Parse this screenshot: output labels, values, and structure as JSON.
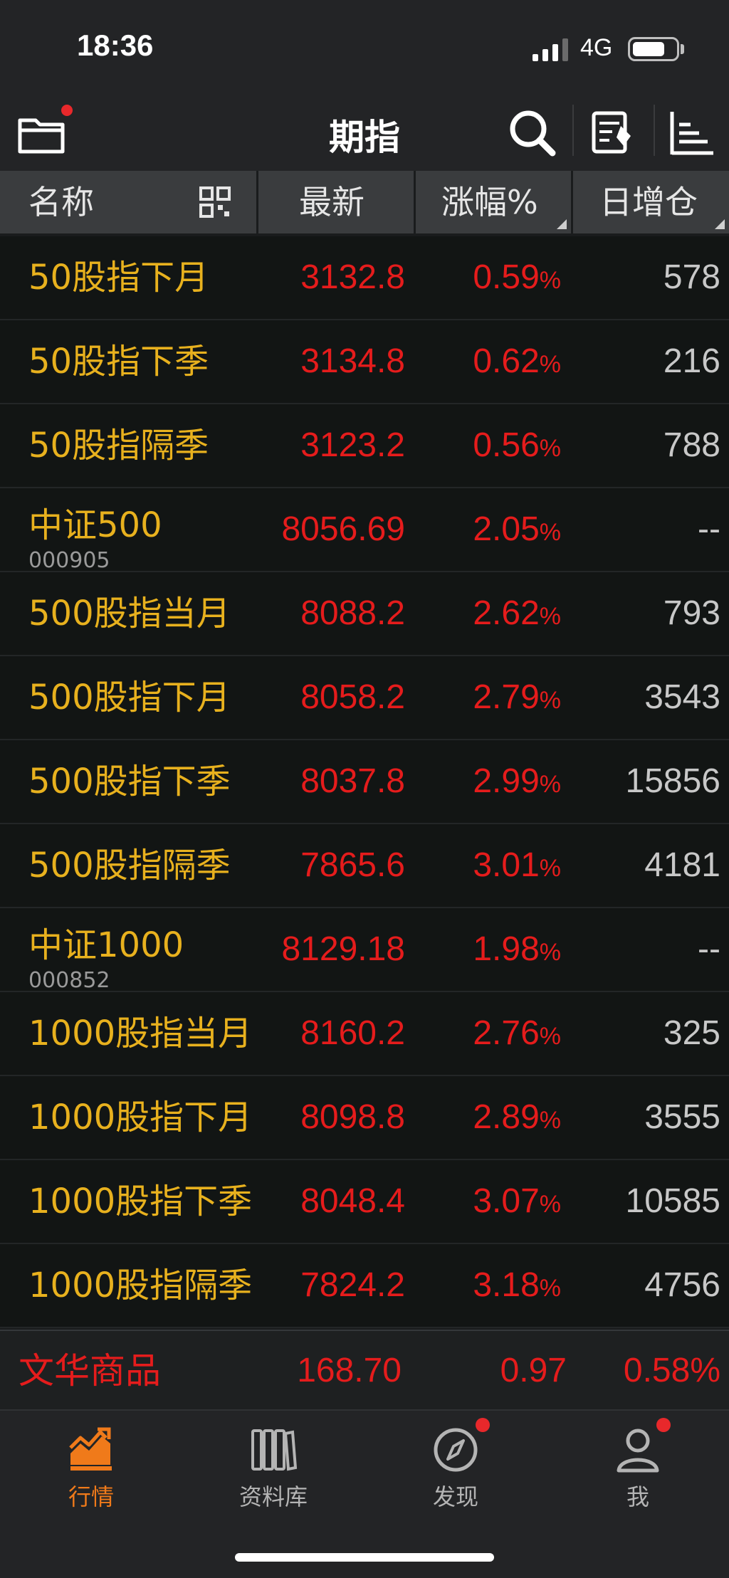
{
  "status_bar": {
    "time": "18:36",
    "network": "4G",
    "battery_level": 0.75
  },
  "nav": {
    "title": "期指"
  },
  "columns": {
    "name": "名称",
    "latest": "最新",
    "change": "涨幅%",
    "oi": "日增仓"
  },
  "rows": [
    {
      "name": "50股指下月",
      "code": "",
      "price": "3132.8",
      "change": "0.59",
      "oi": "578"
    },
    {
      "name": "50股指下季",
      "code": "",
      "price": "3134.8",
      "change": "0.62",
      "oi": "216"
    },
    {
      "name": "50股指隔季",
      "code": "",
      "price": "3123.2",
      "change": "0.56",
      "oi": "788"
    },
    {
      "name": "中证500",
      "code": "000905",
      "price": "8056.69",
      "change": "2.05",
      "oi": "--"
    },
    {
      "name": "500股指当月",
      "code": "",
      "price": "8088.2",
      "change": "2.62",
      "oi": "793"
    },
    {
      "name": "500股指下月",
      "code": "",
      "price": "8058.2",
      "change": "2.79",
      "oi": "3543"
    },
    {
      "name": "500股指下季",
      "code": "",
      "price": "8037.8",
      "change": "2.99",
      "oi": "15856"
    },
    {
      "name": "500股指隔季",
      "code": "",
      "price": "7865.6",
      "change": "3.01",
      "oi": "4181"
    },
    {
      "name": "中证1000",
      "code": "000852",
      "price": "8129.18",
      "change": "1.98",
      "oi": "--"
    },
    {
      "name": "1000股指当月",
      "code": "",
      "price": "8160.2",
      "change": "2.76",
      "oi": "325"
    },
    {
      "name": "1000股指下月",
      "code": "",
      "price": "8098.8",
      "change": "2.89",
      "oi": "3555"
    },
    {
      "name": "1000股指下季",
      "code": "",
      "price": "8048.4",
      "change": "3.07",
      "oi": "10585"
    },
    {
      "name": "1000股指隔季",
      "code": "",
      "price": "7824.2",
      "change": "3.18",
      "oi": "4756"
    }
  ],
  "pct_symbol": "%",
  "ticker": {
    "name": "文华商品",
    "value": "168.70",
    "change": "0.97",
    "percent": "0.58%"
  },
  "tabs": [
    {
      "label": "行情",
      "icon": "chart-trend-icon",
      "active": true
    },
    {
      "label": "资料库",
      "icon": "books-icon",
      "active": false
    },
    {
      "label": "发现",
      "icon": "compass-icon",
      "active": false
    },
    {
      "label": "我",
      "icon": "person-icon",
      "active": false
    }
  ],
  "colors": {
    "name": "#e8b11e",
    "up": "#e51c1c",
    "accent": "#f07a1a",
    "badge": "#e8282b"
  }
}
